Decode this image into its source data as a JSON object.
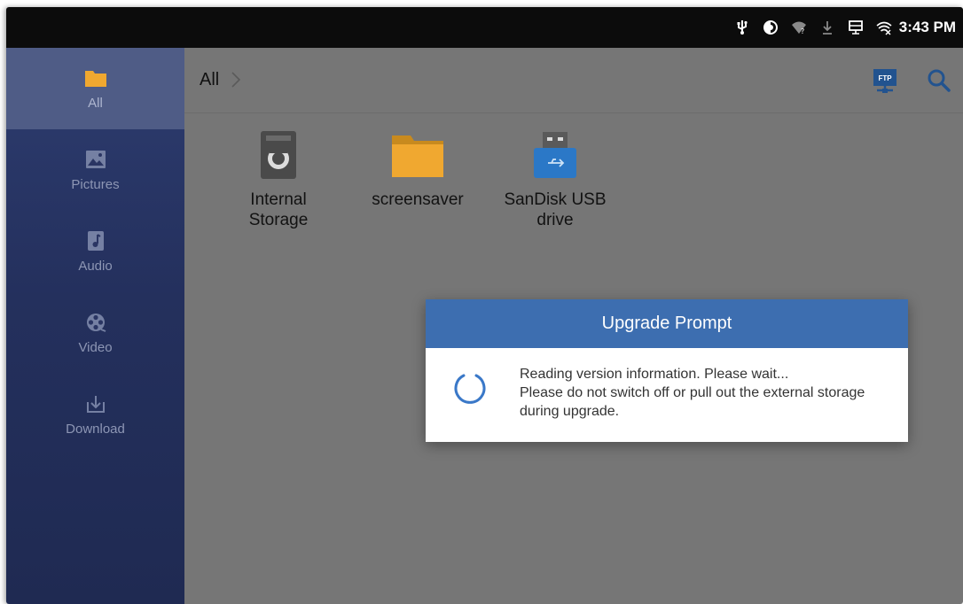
{
  "status_bar": {
    "time": "3:43 PM",
    "icons": [
      "usb-icon",
      "notification-icon",
      "wifi-question-icon",
      "download-icon",
      "monitor-icon",
      "wifi-x-icon"
    ]
  },
  "sidebar": {
    "items": [
      {
        "label": "All",
        "icon": "folder-icon",
        "active": true
      },
      {
        "label": "Pictures",
        "icon": "image-icon",
        "active": false
      },
      {
        "label": "Audio",
        "icon": "music-icon",
        "active": false
      },
      {
        "label": "Video",
        "icon": "film-reel-icon",
        "active": false
      },
      {
        "label": "Download",
        "icon": "download-icon",
        "active": false
      }
    ]
  },
  "toolbar": {
    "breadcrumb": "All",
    "ftp_label": "FTP",
    "search_icon": "search-icon"
  },
  "files": [
    {
      "name": "Internal\nStorage",
      "icon": "hard-drive-icon"
    },
    {
      "name": "screensaver",
      "icon": "folder-icon"
    },
    {
      "name": "SanDisk USB\ndrive",
      "icon": "usb-drive-icon"
    }
  ],
  "dialog": {
    "title": "Upgrade Prompt",
    "line1": "Reading version information. Please wait...",
    "line2": "Please do not switch off or pull out the external storage during upgrade."
  },
  "colors": {
    "accent": "#3d6eb0",
    "folder": "#f0a830",
    "sidebar": "#26325f",
    "overlay": "#767676"
  }
}
